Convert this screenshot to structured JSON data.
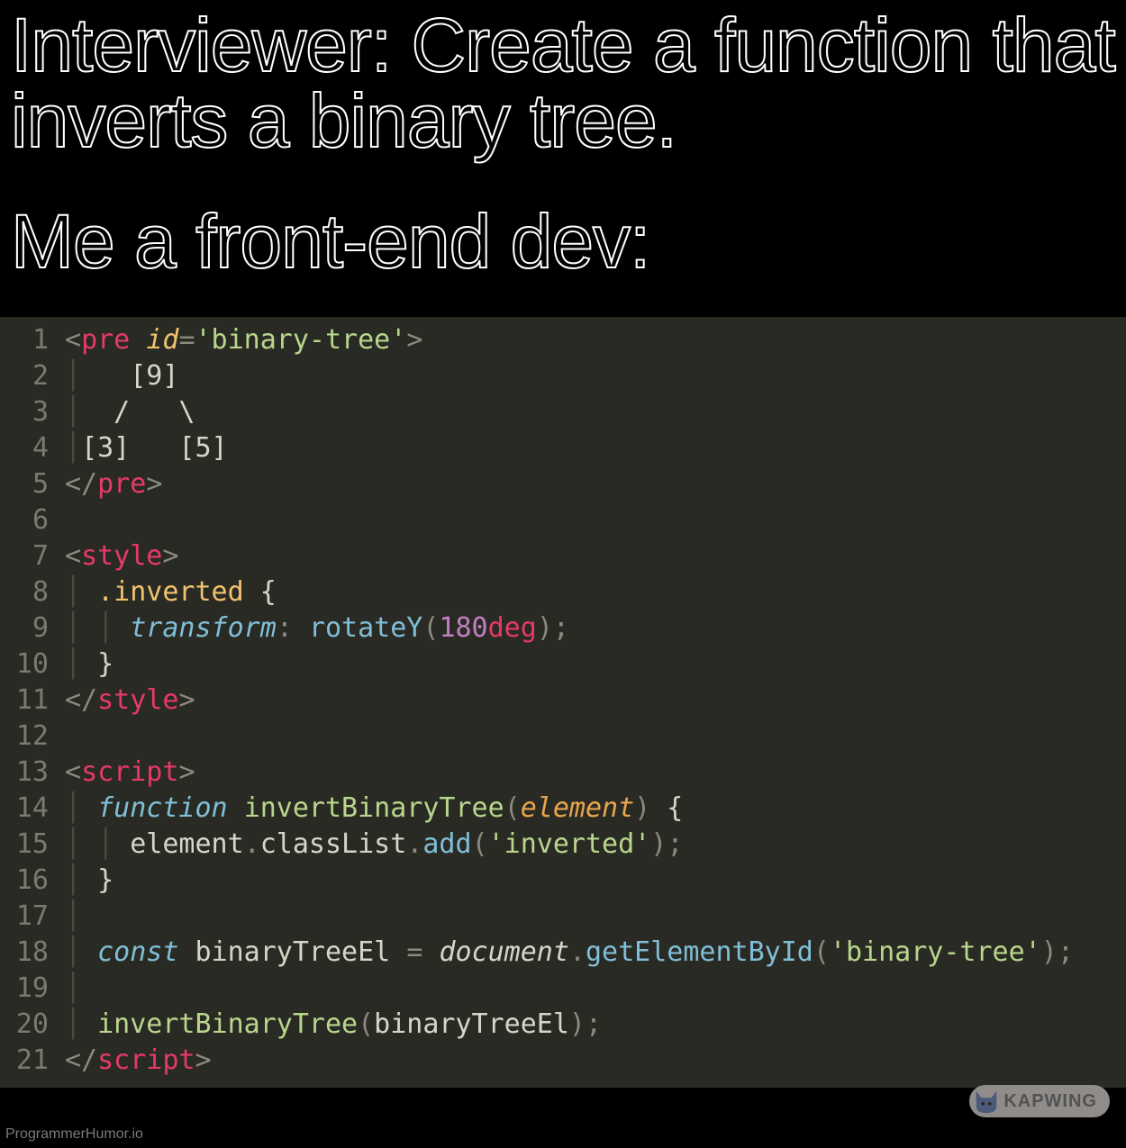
{
  "captions": {
    "top": "Interviewer: Create a function that inverts a binary tree.",
    "mid": "Me a front-end dev:"
  },
  "code": {
    "lines": [
      {
        "n": "1",
        "segments": [
          [
            "punct",
            "<"
          ],
          [
            "tag",
            "pre"
          ],
          [
            "ident",
            " "
          ],
          [
            "attr",
            "id"
          ],
          [
            "punct",
            "="
          ],
          [
            "string",
            "'binary-tree'"
          ],
          [
            "punct",
            ">"
          ]
        ]
      },
      {
        "n": "2",
        "segments": [
          [
            "guide",
            "│ "
          ],
          [
            "ident",
            "  [9]"
          ]
        ]
      },
      {
        "n": "3",
        "segments": [
          [
            "guide",
            "│ "
          ],
          [
            "ident",
            " /   \\"
          ]
        ]
      },
      {
        "n": "4",
        "segments": [
          [
            "guide",
            "│"
          ],
          [
            "ident",
            "[3]   [5]"
          ]
        ]
      },
      {
        "n": "5",
        "segments": [
          [
            "punct",
            "</"
          ],
          [
            "tag",
            "pre"
          ],
          [
            "punct",
            ">"
          ]
        ]
      },
      {
        "n": "6",
        "segments": [
          [
            "ident",
            ""
          ]
        ]
      },
      {
        "n": "7",
        "segments": [
          [
            "punct",
            "<"
          ],
          [
            "tag",
            "style"
          ],
          [
            "punct",
            ">"
          ]
        ]
      },
      {
        "n": "8",
        "segments": [
          [
            "guide",
            "│ "
          ],
          [
            "sel",
            ".inverted"
          ],
          [
            "ident",
            " "
          ],
          [
            "brace",
            "{"
          ]
        ]
      },
      {
        "n": "9",
        "segments": [
          [
            "guide",
            "│ │ "
          ],
          [
            "prop",
            "transform"
          ],
          [
            "punct",
            ":"
          ],
          [
            "ident",
            " "
          ],
          [
            "val",
            "rotateY"
          ],
          [
            "punct",
            "("
          ],
          [
            "num",
            "180"
          ],
          [
            "unit",
            "deg"
          ],
          [
            "punct",
            ")"
          ],
          [
            "punct",
            ";"
          ]
        ]
      },
      {
        "n": "10",
        "segments": [
          [
            "guide",
            "│ "
          ],
          [
            "brace",
            "}"
          ]
        ]
      },
      {
        "n": "11",
        "segments": [
          [
            "punct",
            "</"
          ],
          [
            "tag",
            "style"
          ],
          [
            "punct",
            ">"
          ]
        ]
      },
      {
        "n": "12",
        "segments": [
          [
            "ident",
            ""
          ]
        ]
      },
      {
        "n": "13",
        "segments": [
          [
            "punct",
            "<"
          ],
          [
            "tag",
            "script"
          ],
          [
            "punct",
            ">"
          ]
        ]
      },
      {
        "n": "14",
        "segments": [
          [
            "guide",
            "│ "
          ],
          [
            "kw-fn",
            "function"
          ],
          [
            "ident",
            " "
          ],
          [
            "fn-name",
            "invertBinaryTree"
          ],
          [
            "punct",
            "("
          ],
          [
            "param",
            "element"
          ],
          [
            "punct",
            ")"
          ],
          [
            "ident",
            " "
          ],
          [
            "brace",
            "{"
          ]
        ]
      },
      {
        "n": "15",
        "segments": [
          [
            "guide",
            "│ │ "
          ],
          [
            "ident",
            "element"
          ],
          [
            "punct",
            "."
          ],
          [
            "ident",
            "classList"
          ],
          [
            "punct",
            "."
          ],
          [
            "method",
            "add"
          ],
          [
            "punct",
            "("
          ],
          [
            "string",
            "'inverted'"
          ],
          [
            "punct",
            ")"
          ],
          [
            "punct",
            ";"
          ]
        ]
      },
      {
        "n": "16",
        "segments": [
          [
            "guide",
            "│ "
          ],
          [
            "brace",
            "}"
          ]
        ]
      },
      {
        "n": "17",
        "segments": [
          [
            "guide",
            "│"
          ],
          [
            "ident",
            ""
          ]
        ]
      },
      {
        "n": "18",
        "segments": [
          [
            "guide",
            "│ "
          ],
          [
            "kw-c",
            "const"
          ],
          [
            "ident",
            " binaryTreeEl "
          ],
          [
            "punct",
            "="
          ],
          [
            "ident",
            " "
          ],
          [
            "doc",
            "document"
          ],
          [
            "punct",
            "."
          ],
          [
            "method",
            "getElementById"
          ],
          [
            "punct",
            "("
          ],
          [
            "string",
            "'binary-tree'"
          ],
          [
            "punct",
            ")"
          ],
          [
            "punct",
            ";"
          ]
        ]
      },
      {
        "n": "19",
        "segments": [
          [
            "guide",
            "│"
          ],
          [
            "ident",
            ""
          ]
        ]
      },
      {
        "n": "20",
        "segments": [
          [
            "guide",
            "│ "
          ],
          [
            "fn-name",
            "invertBinaryTree"
          ],
          [
            "punct",
            "("
          ],
          [
            "ident",
            "binaryTreeEl"
          ],
          [
            "punct",
            ")"
          ],
          [
            "punct",
            ";"
          ]
        ]
      },
      {
        "n": "21",
        "segments": [
          [
            "punct",
            "</"
          ],
          [
            "tag",
            "script"
          ],
          [
            "punct",
            ">"
          ]
        ]
      }
    ]
  },
  "watermark": {
    "label": "KAPWING"
  },
  "footer": {
    "credit": "ProgrammerHumor.io"
  }
}
